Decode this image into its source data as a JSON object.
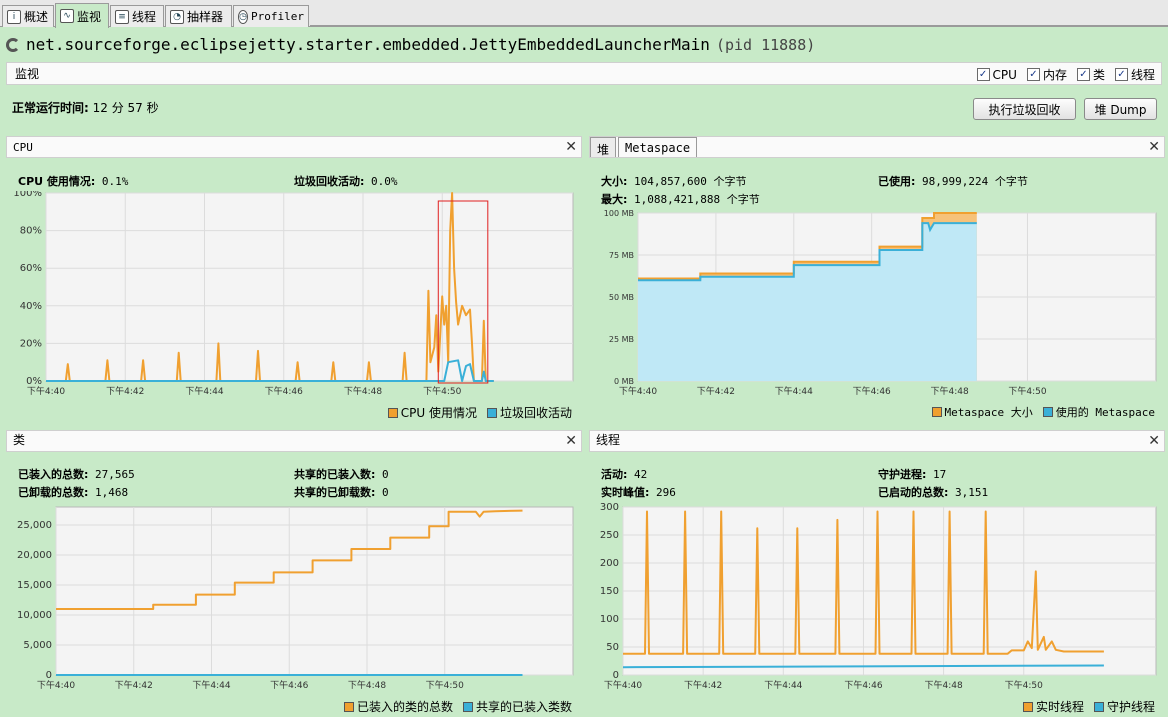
{
  "tabs": [
    {
      "label": "概述",
      "icon": "info-icon"
    },
    {
      "label": "监视",
      "icon": "monitor-chart-icon"
    },
    {
      "label": "线程",
      "icon": "threads-icon"
    },
    {
      "label": "抽样器",
      "icon": "sampler-icon"
    },
    {
      "label": "Profiler",
      "icon": "profiler-clock-icon"
    }
  ],
  "header": {
    "app": "net.sourceforge.eclipsejetty.starter.embedded.JettyEmbeddedLauncherMain",
    "pid": "(pid 11888)"
  },
  "monitor": {
    "label": "监视",
    "checks": [
      "CPU",
      "内存",
      "类",
      "线程"
    ]
  },
  "uptime": {
    "label": "正常运行时间:",
    "value": "12 分 57 秒"
  },
  "buttons": {
    "gc": "执行垃圾回收",
    "dump": "堆 Dump"
  },
  "colors": {
    "orange": "#f0a030",
    "blue": "#3ab0d8",
    "gc_highlight": "#e02020"
  },
  "time_ticks": [
    "下午4:40",
    "下午4:42",
    "下午4:44",
    "下午4:46",
    "下午4:48",
    "下午4:50"
  ],
  "cpu": {
    "title": "CPU",
    "usage_label": "CPU 使用情况:",
    "usage_value": "0.1%",
    "gc_label": "垃圾回收活动:",
    "gc_value": "0.0%",
    "legend": [
      "CPU 使用情况",
      "垃圾回收活动"
    ]
  },
  "heap": {
    "tabs": [
      "堆",
      "Metaspace"
    ],
    "size_label": "大小:",
    "size_value": "104,857,600 个字节",
    "used_label": "已使用:",
    "used_value": "98,999,224 个字节",
    "max_label": "最大:",
    "max_value": "1,088,421,888 个字节",
    "legend": [
      "Metaspace 大小",
      "使用的 Metaspace"
    ]
  },
  "classes": {
    "title": "类",
    "loaded_label": "已装入的总数:",
    "loaded_value": "27,565",
    "unloaded_label": "已卸载的总数:",
    "unloaded_value": "1,468",
    "shared_loaded_label": "共享的已装入数:",
    "shared_loaded_value": "0",
    "shared_unloaded_label": "共享的已卸载数:",
    "shared_unloaded_value": "0",
    "legend": [
      "已装入的类的总数",
      "共享的已装入类数"
    ]
  },
  "threads": {
    "title": "线程",
    "live_label": "活动:",
    "live_value": "42",
    "daemon_label": "守护进程:",
    "daemon_value": "17",
    "peak_label": "实时峰值:",
    "peak_value": "296",
    "started_label": "已启动的总数:",
    "started_value": "3,151",
    "legend": [
      "实时线程",
      "守护线程"
    ]
  },
  "chart_data": [
    {
      "type": "line",
      "name": "cpu",
      "x_range": [
        0,
        13.3
      ],
      "ylim": [
        0,
        100
      ],
      "yticks": [
        "0%",
        "20%",
        "40%",
        "60%",
        "80%",
        "100%"
      ],
      "ytick_values": [
        0,
        20,
        40,
        60,
        80,
        100
      ],
      "series": [
        {
          "name": "CPU 使用情况",
          "points": [
            [
              0,
              0
            ],
            [
              0.5,
              0
            ],
            [
              0.55,
              9
            ],
            [
              0.6,
              0
            ],
            [
              1.5,
              0
            ],
            [
              1.55,
              11
            ],
            [
              1.6,
              0
            ],
            [
              2.4,
              0
            ],
            [
              2.45,
              11
            ],
            [
              2.5,
              0
            ],
            [
              3.3,
              0
            ],
            [
              3.35,
              15
            ],
            [
              3.4,
              0
            ],
            [
              4.3,
              0
            ],
            [
              4.35,
              20
            ],
            [
              4.4,
              0
            ],
            [
              5.3,
              0
            ],
            [
              5.35,
              16
            ],
            [
              5.4,
              0
            ],
            [
              6.3,
              0
            ],
            [
              6.35,
              10
            ],
            [
              6.4,
              0
            ],
            [
              7.2,
              0
            ],
            [
              7.25,
              10
            ],
            [
              7.3,
              0
            ],
            [
              8.1,
              0
            ],
            [
              8.15,
              10
            ],
            [
              8.2,
              0
            ],
            [
              9.0,
              0
            ],
            [
              9.05,
              15
            ],
            [
              9.1,
              0
            ],
            [
              9.6,
              0
            ],
            [
              9.65,
              48
            ],
            [
              9.7,
              10
            ],
            [
              9.8,
              18
            ],
            [
              9.85,
              35
            ],
            [
              9.9,
              5
            ],
            [
              10.0,
              45
            ],
            [
              10.05,
              30
            ],
            [
              10.1,
              40
            ],
            [
              10.15,
              10
            ],
            [
              10.2,
              80
            ],
            [
              10.25,
              100
            ],
            [
              10.3,
              60
            ],
            [
              10.35,
              42
            ],
            [
              10.4,
              30
            ],
            [
              10.5,
              40
            ],
            [
              10.6,
              35
            ],
            [
              10.7,
              38
            ],
            [
              10.75,
              20
            ],
            [
              10.8,
              0
            ],
            [
              11.0,
              0
            ],
            [
              11.05,
              32
            ],
            [
              11.1,
              0
            ],
            [
              11.3,
              0
            ]
          ]
        },
        {
          "name": "垃圾回收活动",
          "points": [
            [
              0,
              0
            ],
            [
              10.05,
              0
            ],
            [
              10.1,
              5
            ],
            [
              10.15,
              10
            ],
            [
              10.4,
              11
            ],
            [
              10.5,
              0
            ],
            [
              10.6,
              8
            ],
            [
              10.7,
              9
            ],
            [
              10.8,
              0
            ],
            [
              11.0,
              0
            ],
            [
              11.05,
              5
            ],
            [
              11.1,
              0
            ],
            [
              11.3,
              0
            ]
          ]
        }
      ]
    },
    {
      "type": "area",
      "name": "metaspace",
      "x_range": [
        0,
        13.3
      ],
      "ylim": [
        0,
        100
      ],
      "yticks": [
        "0 MB",
        "25 MB",
        "50 MB",
        "75 MB",
        "100 MB"
      ],
      "ytick_values": [
        0,
        25,
        50,
        75,
        100
      ],
      "series": [
        {
          "name": "Metaspace 大小",
          "points": [
            [
              0,
              61
            ],
            [
              1.6,
              61
            ],
            [
              1.6,
              64
            ],
            [
              4.0,
              64
            ],
            [
              4.0,
              71
            ],
            [
              6.2,
              71
            ],
            [
              6.2,
              80
            ],
            [
              7.3,
              80
            ],
            [
              7.3,
              97
            ],
            [
              7.6,
              97
            ],
            [
              7.6,
              100
            ],
            [
              8.7,
              100
            ]
          ]
        },
        {
          "name": "使用的 Metaspace",
          "points": [
            [
              0,
              60
            ],
            [
              1.6,
              60
            ],
            [
              1.6,
              62
            ],
            [
              4.0,
              62
            ],
            [
              4.0,
              69
            ],
            [
              6.2,
              69
            ],
            [
              6.2,
              78
            ],
            [
              7.3,
              78
            ],
            [
              7.3,
              94
            ],
            [
              7.45,
              94
            ],
            [
              7.5,
              90
            ],
            [
              7.6,
              94
            ],
            [
              8.7,
              94
            ]
          ]
        }
      ]
    },
    {
      "type": "line",
      "name": "classes",
      "x_range": [
        0,
        13.3
      ],
      "ylim": [
        0,
        28000
      ],
      "yticks": [
        "0",
        "5,000",
        "10,000",
        "15,000",
        "20,000",
        "25,000"
      ],
      "ytick_values": [
        0,
        5000,
        10000,
        15000,
        20000,
        25000
      ],
      "series": [
        {
          "name": "已装入的类的总数",
          "points": [
            [
              0,
              11000
            ],
            [
              2.5,
              11000
            ],
            [
              2.5,
              11700
            ],
            [
              3.6,
              11700
            ],
            [
              3.6,
              13400
            ],
            [
              4.6,
              13400
            ],
            [
              4.6,
              15400
            ],
            [
              5.6,
              15400
            ],
            [
              5.6,
              17100
            ],
            [
              6.6,
              17100
            ],
            [
              6.6,
              19100
            ],
            [
              7.6,
              19100
            ],
            [
              7.6,
              21000
            ],
            [
              8.6,
              21000
            ],
            [
              8.6,
              22900
            ],
            [
              9.6,
              22900
            ],
            [
              9.6,
              24800
            ],
            [
              10.1,
              24800
            ],
            [
              10.1,
              27200
            ],
            [
              10.8,
              27200
            ],
            [
              10.9,
              26400
            ],
            [
              11.0,
              27200
            ],
            [
              11.3,
              27300
            ],
            [
              12.0,
              27400
            ]
          ]
        },
        {
          "name": "共享的已装入类数",
          "points": [
            [
              0,
              0
            ],
            [
              12.0,
              0
            ]
          ]
        }
      ]
    },
    {
      "type": "line",
      "name": "threads",
      "x_range": [
        0,
        13.3
      ],
      "ylim": [
        0,
        300
      ],
      "yticks": [
        "0",
        "50",
        "100",
        "150",
        "200",
        "250",
        "300"
      ],
      "ytick_values": [
        0,
        50,
        100,
        150,
        200,
        250,
        300
      ],
      "series": [
        {
          "name": "实时线程",
          "points": [
            [
              0,
              38
            ],
            [
              0.55,
              38
            ],
            [
              0.6,
              292
            ],
            [
              0.65,
              38
            ],
            [
              1.5,
              38
            ],
            [
              1.55,
              292
            ],
            [
              1.6,
              38
            ],
            [
              2.4,
              38
            ],
            [
              2.45,
              292
            ],
            [
              2.5,
              38
            ],
            [
              3.3,
              38
            ],
            [
              3.35,
              262
            ],
            [
              3.4,
              38
            ],
            [
              4.3,
              38
            ],
            [
              4.35,
              262
            ],
            [
              4.4,
              38
            ],
            [
              5.3,
              38
            ],
            [
              5.35,
              277
            ],
            [
              5.4,
              38
            ],
            [
              6.3,
              38
            ],
            [
              6.35,
              292
            ],
            [
              6.4,
              38
            ],
            [
              7.2,
              38
            ],
            [
              7.25,
              292
            ],
            [
              7.3,
              38
            ],
            [
              8.1,
              38
            ],
            [
              8.15,
              292
            ],
            [
              8.2,
              38
            ],
            [
              9.0,
              38
            ],
            [
              9.05,
              292
            ],
            [
              9.1,
              38
            ],
            [
              9.6,
              38
            ],
            [
              9.7,
              44
            ],
            [
              10.0,
              44
            ],
            [
              10.1,
              60
            ],
            [
              10.2,
              48
            ],
            [
              10.3,
              185
            ],
            [
              10.35,
              45
            ],
            [
              10.5,
              68
            ],
            [
              10.55,
              45
            ],
            [
              10.7,
              60
            ],
            [
              10.8,
              45
            ],
            [
              11.0,
              42
            ],
            [
              12.0,
              42
            ]
          ]
        },
        {
          "name": "守护线程",
          "points": [
            [
              0,
              14
            ],
            [
              12.0,
              17
            ]
          ]
        }
      ]
    }
  ]
}
